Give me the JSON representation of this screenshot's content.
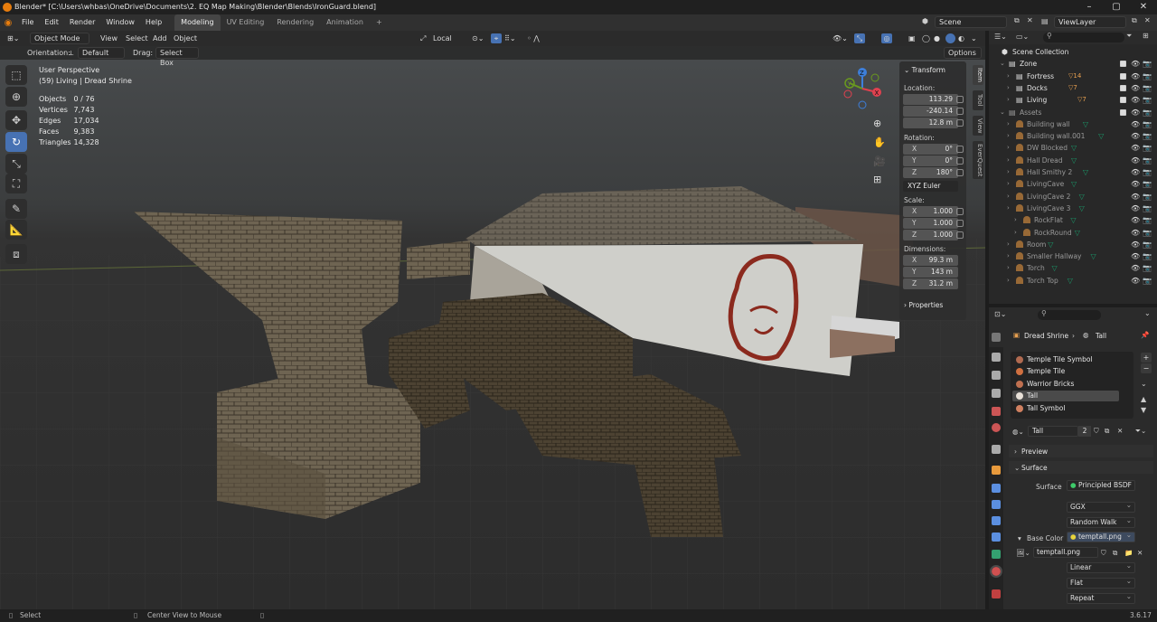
{
  "title": "Blender* [C:\\Users\\whbas\\OneDrive\\Documents\\2. EQ Map Making\\Blender\\Blends\\IronGuard.blend]",
  "menu": [
    "File",
    "Edit",
    "Render",
    "Window",
    "Help"
  ],
  "workspaces": [
    "Modeling",
    "UV Editing",
    "Rendering",
    "Animation",
    "+"
  ],
  "scene": "Scene",
  "view_layer": "ViewLayer",
  "viewport_header": {
    "mode": "Object Mode",
    "menus": [
      "View",
      "Select",
      "Add",
      "Object"
    ],
    "transform_space": "Local",
    "orientation_label": "Orientation:",
    "orientation": "Default",
    "drag_label": "Drag:",
    "drag": "Select Box",
    "options": "Options"
  },
  "overlay_info": {
    "view": "User Perspective",
    "context": "(59) Living | Dread Shrine",
    "stats": [
      {
        "k": "Objects",
        "v": "0 / 76"
      },
      {
        "k": "Vertices",
        "v": "7,743"
      },
      {
        "k": "Edges",
        "v": "17,034"
      },
      {
        "k": "Faces",
        "v": "9,383"
      },
      {
        "k": "Triangles",
        "v": "14,328"
      }
    ]
  },
  "gizmo": {
    "x": "X",
    "y": "Y",
    "z": "Z"
  },
  "npanel": {
    "transform": "Transform",
    "location_label": "Location:",
    "location": [
      "113.29",
      "-240.14",
      "12.8 m"
    ],
    "rotation_label": "Rotation:",
    "rotation": [
      {
        "ax": "X",
        "v": "0°"
      },
      {
        "ax": "Y",
        "v": "0°"
      },
      {
        "ax": "Z",
        "v": "180°"
      }
    ],
    "rotation_mode": "XYZ Euler",
    "scale_label": "Scale:",
    "scale": [
      {
        "ax": "X",
        "v": "1.000"
      },
      {
        "ax": "Y",
        "v": "1.000"
      },
      {
        "ax": "Z",
        "v": "1.000"
      }
    ],
    "dimensions_label": "Dimensions:",
    "dimensions": [
      {
        "ax": "X",
        "v": "99.3 m"
      },
      {
        "ax": "Y",
        "v": "143 m"
      },
      {
        "ax": "Z",
        "v": "31.2 m"
      }
    ],
    "properties": "Properties"
  },
  "side_tabs": [
    "Item",
    "Tool",
    "View",
    "EverQuest"
  ],
  "outliner": {
    "rows": [
      {
        "name": "Scene Collection",
        "dim": false
      },
      {
        "name": "Zone",
        "dim": false
      },
      {
        "name": "Fortress",
        "dim": false,
        "badge": "14"
      },
      {
        "name": "Docks",
        "dim": false,
        "badge": "7"
      },
      {
        "name": "Living",
        "dim": false,
        "badge": "7"
      },
      {
        "name": "Assets",
        "dim": true
      },
      {
        "name": "Building wall",
        "dim": true
      },
      {
        "name": "Building wall.001",
        "dim": true
      },
      {
        "name": "DW Blocked",
        "dim": true
      },
      {
        "name": "Hall Dread",
        "dim": true
      },
      {
        "name": "Hall Smithy 2",
        "dim": true
      },
      {
        "name": "LivingCave",
        "dim": true
      },
      {
        "name": "LivingCave 2",
        "dim": true
      },
      {
        "name": "LivingCave 3",
        "dim": true
      },
      {
        "name": "RockFlat",
        "dim": true
      },
      {
        "name": "RockRound",
        "dim": true
      },
      {
        "name": "Room",
        "dim": true
      },
      {
        "name": "Smaller Hallway",
        "dim": true
      },
      {
        "name": "Torch",
        "dim": true
      },
      {
        "name": "Torch Top",
        "dim": true
      }
    ]
  },
  "properties": {
    "breadcrumb_object": "Dread Shrine",
    "breadcrumb_material": "Tall",
    "materials": [
      "Temple Tile Symbol",
      "Temple Tile",
      "Warrior Bricks",
      "Tall",
      "Tall Symbol"
    ],
    "selected_material": "Tall",
    "material_users": "2",
    "preview": "Preview",
    "surface_section": "Surface",
    "surface_label": "Surface",
    "surface_value": "Principled BSDF",
    "distribution": "GGX",
    "subsurface": "Random Walk",
    "base_color_label": "Base Color",
    "base_color_value": "temptall.png",
    "image_name": "temptall.png",
    "interpolation": "Linear",
    "projection": "Flat",
    "extension": "Repeat"
  },
  "status": {
    "select": "Select",
    "center": "Center View to Mouse",
    "version": "3.6.17"
  }
}
